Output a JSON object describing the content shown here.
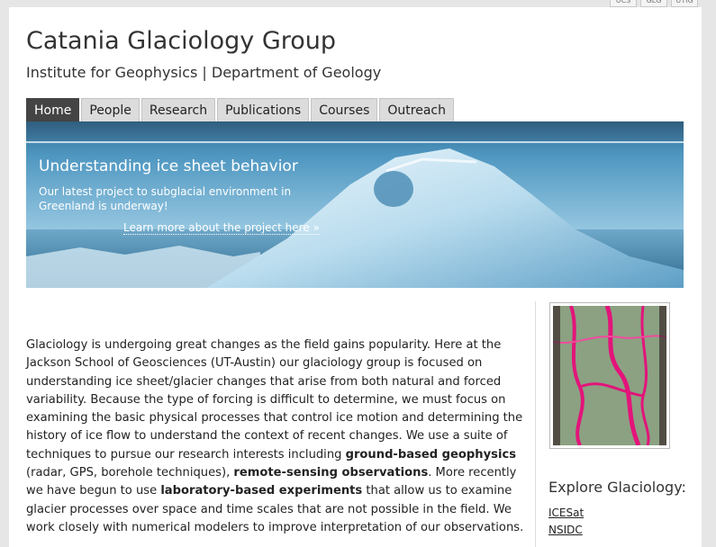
{
  "utility_tabs": [
    "UCS",
    "GLG",
    "UTIG"
  ],
  "site": {
    "title": "Catania Glaciology Group",
    "subtitle": "Institute for Geophysics | Department of Geology"
  },
  "nav": {
    "items": [
      {
        "label": "Home",
        "active": true
      },
      {
        "label": "People"
      },
      {
        "label": "Research"
      },
      {
        "label": "Publications"
      },
      {
        "label": "Courses"
      },
      {
        "label": "Outreach"
      }
    ]
  },
  "banner": {
    "heading": "Understanding ice sheet behavior",
    "text": "Our latest project to subglacial environment in Greenland is underway!",
    "link": "Learn more about the project here »"
  },
  "intro": {
    "p1": "Glaciology is undergoing great changes as the field gains popularity. Here at the Jackson School of Geosciences (UT-Austin) our glaciology group is focused on understanding ice sheet/glacier changes that arise from both natural and forced variability. Because the type of forcing is difficult to determine, we must focus on examining the basic physical processes that control ice motion and determining the history of ice flow to understand the context of recent changes. We use a suite of techniques to pursue our research interests including ",
    "b1": "ground-based geophysics",
    "p2": " (radar, GPS, borehole techniques), ",
    "b2": "remote-sensing observations",
    "p3": ". More recently we have begun to use ",
    "b3": "laboratory-based experiments",
    "p4": " that allow us to examine glacier processes over space and time scales that are not possible in the field. We work closely with numerical modelers to improve interpretation of our observations."
  },
  "sidebar": {
    "explore_heading": "Explore Glaciology:",
    "links": [
      "ICESat",
      "NSIDC"
    ]
  }
}
